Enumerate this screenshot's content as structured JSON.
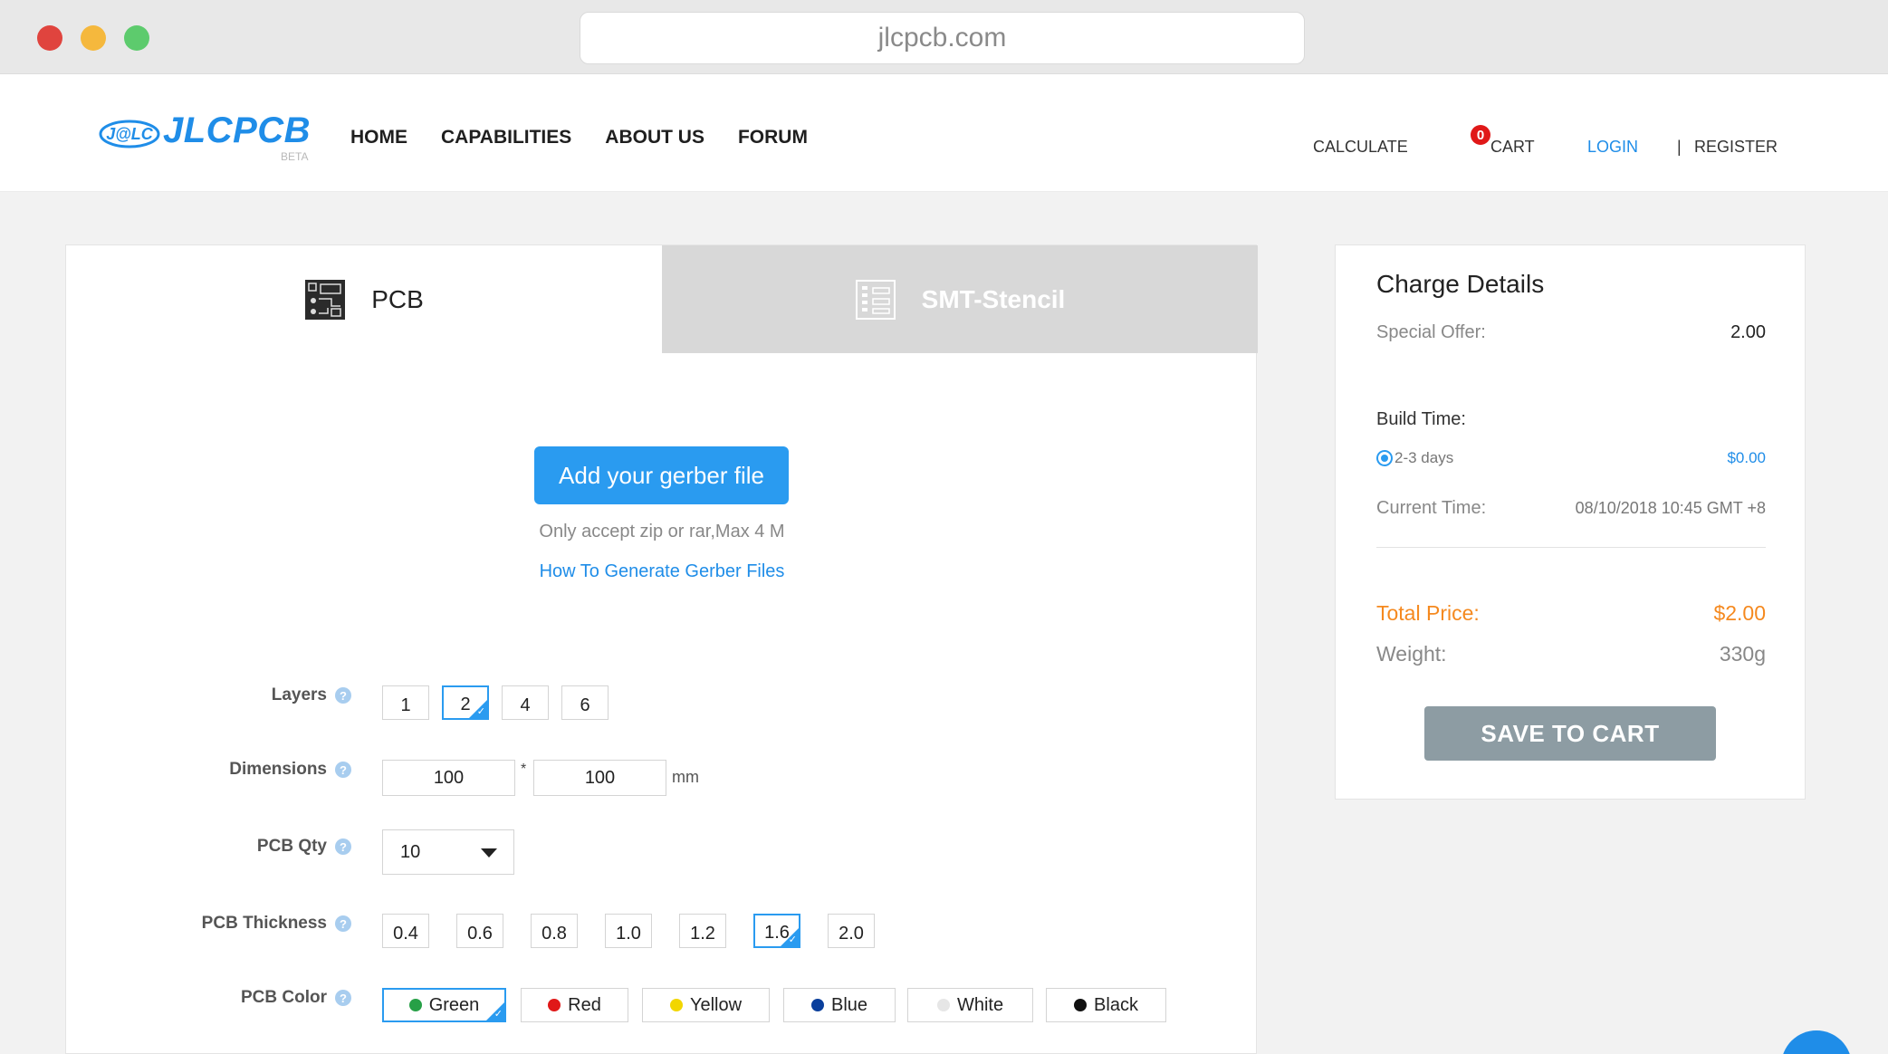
{
  "browser": {
    "url": "jlcpcb.com"
  },
  "header": {
    "logo": {
      "badge": "J@LC",
      "text": "JLCPCB",
      "beta": "BETA"
    },
    "nav": [
      "HOME",
      "CAPABILITIES",
      "ABOUT US",
      "FORUM"
    ],
    "right_nav": {
      "calculate": "CALCULATE",
      "cart_count": "0",
      "cart": "CART",
      "login": "LOGIN",
      "separator": "|",
      "register": "REGISTER"
    }
  },
  "tabs": [
    {
      "label": "PCB",
      "icon": "pcb-board-icon",
      "active": true
    },
    {
      "label": "SMT-Stencil",
      "icon": "stencil-icon",
      "active": false
    }
  ],
  "upload": {
    "button": "Add your gerber file",
    "note": "Only accept zip or rar,Max 4 M",
    "link": "How To Generate Gerber Files"
  },
  "options": {
    "layers": {
      "label": "Layers",
      "values": [
        "1",
        "2",
        "4",
        "6"
      ],
      "selected": "2"
    },
    "dimensions": {
      "label": "Dimensions",
      "width": "100",
      "star": "*",
      "height": "100",
      "unit": "mm"
    },
    "qty": {
      "label": "PCB Qty",
      "value": "10"
    },
    "thickness": {
      "label": "PCB Thickness",
      "values": [
        "0.4",
        "0.6",
        "0.8",
        "1.0",
        "1.2",
        "1.6",
        "2.0"
      ],
      "selected": "1.6"
    },
    "color": {
      "label": "PCB Color",
      "values": [
        {
          "name": "Green",
          "hex": "#27a047"
        },
        {
          "name": "Red",
          "hex": "#e01818"
        },
        {
          "name": "Yellow",
          "hex": "#f2d600"
        },
        {
          "name": "Blue",
          "hex": "#0a3f9c"
        },
        {
          "name": "White",
          "hex": "#e6e6e6"
        },
        {
          "name": "Black",
          "hex": "#111111"
        }
      ],
      "selected": "Green"
    }
  },
  "charge": {
    "title": "Charge Details",
    "special_offer_label": "Special Offer:",
    "special_offer_value": "2.00",
    "build_time_label": "Build Time:",
    "build_option": "2-3 days",
    "build_price": "$0.00",
    "current_time_label": "Current Time:",
    "current_time_value": "08/10/2018 10:45 GMT +8",
    "total_label": "Total Price:",
    "total_value": "$2.00",
    "weight_label": "Weight:",
    "weight_value": "330g",
    "save_button": "SAVE TO CART"
  },
  "colors": {
    "accent": "#2a9bf0",
    "orange": "#f5891f",
    "save_button": "#8d9ca3",
    "tab_inactive": "#d8d8d8"
  }
}
